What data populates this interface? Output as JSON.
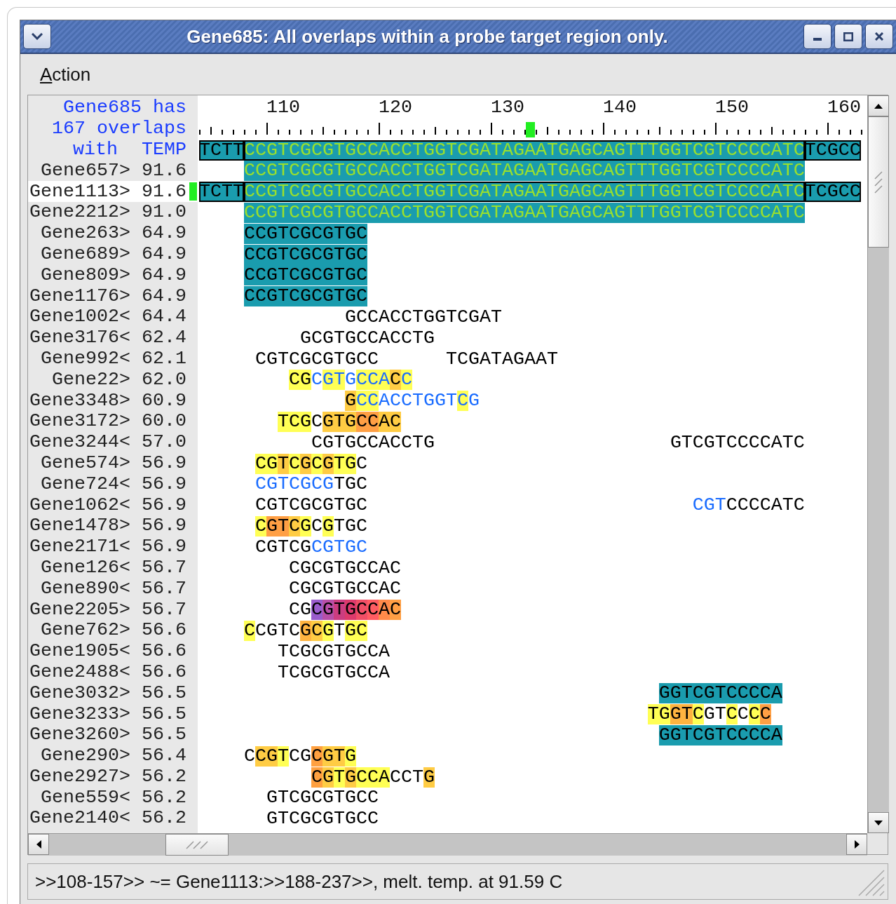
{
  "window": {
    "title": "Gene685: All overlaps within a probe target region only."
  },
  "menu": [
    "Action"
  ],
  "header": {
    "lines": [
      "Gene685 has",
      "167 overlaps"
    ],
    "label": "with",
    "temp": "TEMP"
  },
  "ruler": {
    "labels": [
      "110",
      "120",
      "130",
      "140",
      "150",
      "160"
    ]
  },
  "probe": {
    "outlined": true,
    "runs": [
      {
        "kind": "plain",
        "text": "TCTT",
        "color": "#1a9cae"
      },
      {
        "kind": "green",
        "text": "CCGTCGCGTGCCACCTGGTCGATAGAATGAGCAGTTTGGTCGTCCCCATC",
        "color": "#1a9cae"
      },
      {
        "kind": "plain",
        "text": "TCGCC",
        "color": "#1a9cae"
      }
    ]
  },
  "rows": [
    {
      "label": "Gene657>",
      "temp": "91.6",
      "selected": false,
      "outlined": false,
      "runs": [
        {
          "kind": "green",
          "text": "    CCGTCGCGTGCCACCTGGTCGATAGAATGAGCAGTTTGGTCGTCCCCATC",
          "color": "#1a9cae"
        }
      ]
    },
    {
      "label": "Gene1113>",
      "temp": "91.6",
      "selected": true,
      "outlined": true,
      "runs": [
        {
          "kind": "plain",
          "text": "TCTT",
          "color": "#1a9cae"
        },
        {
          "kind": "green",
          "text": "CCGTCGCGTGCCACCTGGTCGATAGAATGAGCAGTTTGGTCGTCCCCATC",
          "color": "#1a9cae"
        },
        {
          "kind": "plain",
          "text": "TCGCC",
          "color": "#1a9cae"
        }
      ]
    },
    {
      "label": "Gene2212>",
      "temp": "91.0",
      "selected": false,
      "outlined": false,
      "runs": [
        {
          "kind": "green",
          "text": "    CCGTCGCGTGCCACCTGGTCGATAGAATGAGCAGTTTGGTCGTCCCCATC",
          "color": "#1a9cae"
        }
      ]
    },
    {
      "label": "Gene263>",
      "temp": "64.9",
      "selected": false,
      "outlined": false,
      "runs": [
        {
          "kind": "plain",
          "text": "    CCGTCGCGTGC",
          "color": "#1a9cae"
        }
      ]
    },
    {
      "label": "Gene689>",
      "temp": "64.9",
      "selected": false,
      "outlined": false,
      "runs": [
        {
          "kind": "plain",
          "text": "    CCGTCGCGTGC",
          "color": "#1a9cae"
        }
      ]
    },
    {
      "label": "Gene809>",
      "temp": "64.9",
      "selected": false,
      "outlined": false,
      "runs": [
        {
          "kind": "plain",
          "text": "    CCGTCGCGTGC",
          "color": "#1a9cae"
        }
      ]
    },
    {
      "label": "Gene1176>",
      "temp": "64.9",
      "selected": false,
      "outlined": false,
      "runs": [
        {
          "kind": "plain",
          "text": "    CCGTCGCGTGC",
          "color": "#1a9cae"
        }
      ]
    },
    {
      "label": "Gene1002<",
      "temp": "64.4",
      "selected": false,
      "outlined": false,
      "runs": [
        {
          "kind": "plain",
          "text": "             GCCACCTGGTCGAT"
        }
      ]
    },
    {
      "label": "Gene3176<",
      "temp": "62.4",
      "selected": false,
      "outlined": false,
      "runs": [
        {
          "kind": "plain",
          "text": "         GCGTGCCACCTG"
        }
      ]
    },
    {
      "label": "Gene992<",
      "temp": "62.1",
      "selected": false,
      "outlined": false,
      "runs": [
        {
          "kind": "plain",
          "text": "     CGTCGCGTGCC"
        },
        {
          "kind": "plain",
          "text": "      TCGATAGAAT"
        }
      ]
    },
    {
      "label": "Gene22>",
      "temp": "62.0",
      "selected": false,
      "outlined": false,
      "runs": [
        {
          "kind": "plain",
          "text": "        CG",
          "color": "#ffff55"
        },
        {
          "kind": "blue",
          "text": "C"
        },
        {
          "kind": "blue",
          "text": "GT",
          "color": "#ffff55"
        },
        {
          "kind": "blue",
          "text": "G"
        },
        {
          "kind": "blue",
          "text": "CCA",
          "color": "#ffff55"
        },
        {
          "kind": "plain",
          "text": "C",
          "color": "#ffcc44"
        },
        {
          "kind": "blue",
          "text": "C",
          "color": "#ffff55"
        }
      ]
    },
    {
      "label": "Gene3348>",
      "temp": "60.9",
      "selected": false,
      "outlined": false,
      "runs": [
        {
          "kind": "plain",
          "text": "             G",
          "color": "#ffcc44"
        },
        {
          "kind": "blue",
          "text": "CC",
          "color": "#ffff55"
        },
        {
          "kind": "blue",
          "text": "ACCTGGT"
        },
        {
          "kind": "blue",
          "text": "C",
          "color": "#ffff55"
        },
        {
          "kind": "blue",
          "text": "G"
        }
      ]
    },
    {
      "label": "Gene3172>",
      "temp": "60.0",
      "selected": false,
      "outlined": false,
      "runs": [
        {
          "kind": "plain",
          "text": "       TCG",
          "color": "#ffff55"
        },
        {
          "kind": "plain",
          "text": "C"
        },
        {
          "kind": "plain",
          "text": "GTG",
          "color": "#ffcc44"
        },
        {
          "kind": "plain",
          "text": "CC",
          "color": "#ff9f44"
        },
        {
          "kind": "plain",
          "text": "AC",
          "color": "#ffcc44"
        }
      ]
    },
    {
      "label": "Gene3244<",
      "temp": "57.0",
      "selected": false,
      "outlined": false,
      "runs": [
        {
          "kind": "plain",
          "text": "          CGTGCCACCTG"
        },
        {
          "kind": "plain",
          "text": "                     GTCGTCCCCATC"
        }
      ]
    },
    {
      "label": "Gene574>",
      "temp": "56.9",
      "selected": false,
      "outlined": false,
      "runs": [
        {
          "kind": "plain",
          "text": "     CG",
          "color": "#ffff55"
        },
        {
          "kind": "plain",
          "text": "T",
          "color": "#ffcc44"
        },
        {
          "kind": "plain",
          "text": "C",
          "color": "#ffff55"
        },
        {
          "kind": "plain",
          "text": "G",
          "color": "#ffcc44"
        },
        {
          "kind": "plain",
          "text": "C",
          "color": "#ffff55"
        },
        {
          "kind": "plain",
          "text": "G",
          "color": "#ffcc44"
        },
        {
          "kind": "plain",
          "text": "TG",
          "color": "#ffff55"
        },
        {
          "kind": "plain",
          "text": "C"
        }
      ]
    },
    {
      "label": "Gene724<",
      "temp": "56.9",
      "selected": false,
      "outlined": false,
      "runs": [
        {
          "kind": "blue",
          "text": "     CGTCGCG"
        },
        {
          "kind": "plain",
          "text": "TGC"
        }
      ]
    },
    {
      "label": "Gene1062<",
      "temp": "56.9",
      "selected": false,
      "outlined": false,
      "runs": [
        {
          "kind": "plain",
          "text": "     CGTCGCGTGC"
        },
        {
          "kind": "blue",
          "text": "                             CGT"
        },
        {
          "kind": "plain",
          "text": "CCCCATC"
        }
      ]
    },
    {
      "label": "Gene1478>",
      "temp": "56.9",
      "selected": false,
      "outlined": false,
      "runs": [
        {
          "kind": "plain",
          "text": "     C",
          "color": "#ffff55"
        },
        {
          "kind": "plain",
          "text": "GT",
          "color": "#ff9f44"
        },
        {
          "kind": "plain",
          "text": "C",
          "color": "#ffcc44"
        },
        {
          "kind": "plain",
          "text": "G",
          "color": "#ffff55"
        },
        {
          "kind": "plain",
          "text": "C"
        },
        {
          "kind": "plain",
          "text": "G",
          "color": "#ffff55"
        },
        {
          "kind": "plain",
          "text": "TGC"
        }
      ]
    },
    {
      "label": "Gene2171<",
      "temp": "56.9",
      "selected": false,
      "outlined": false,
      "runs": [
        {
          "kind": "plain",
          "text": "     CGTCG"
        },
        {
          "kind": "blue",
          "text": "CGTGC"
        }
      ]
    },
    {
      "label": "Gene126<",
      "temp": "56.7",
      "selected": false,
      "outlined": false,
      "runs": [
        {
          "kind": "plain",
          "text": "        CGCGTGCCAC"
        }
      ]
    },
    {
      "label": "Gene890<",
      "temp": "56.7",
      "selected": false,
      "outlined": false,
      "runs": [
        {
          "kind": "plain",
          "text": "        CGCGTGCCAC"
        }
      ]
    },
    {
      "label": "Gene2205>",
      "temp": "56.7",
      "selected": false,
      "outlined": false,
      "runs": [
        {
          "kind": "plain",
          "text": "        CG"
        },
        {
          "kind": "plain",
          "text": "C",
          "color": "#9a5ccc"
        },
        {
          "kind": "plain",
          "text": "G",
          "color": "#b94fa8"
        },
        {
          "kind": "plain",
          "text": "T",
          "color": "#cc3d80"
        },
        {
          "kind": "plain",
          "text": "G",
          "color": "#dd3a6c"
        },
        {
          "kind": "plain",
          "text": "C",
          "color": "#f04e66"
        },
        {
          "kind": "plain",
          "text": "C",
          "color": "#ff5c62"
        },
        {
          "kind": "plain",
          "text": "A",
          "color": "#ff8a4a"
        },
        {
          "kind": "plain",
          "text": "C",
          "color": "#ff9f44"
        }
      ]
    },
    {
      "label": "Gene762>",
      "temp": "56.6",
      "selected": false,
      "outlined": false,
      "runs": [
        {
          "kind": "plain",
          "text": "    C",
          "color": "#ffff55"
        },
        {
          "kind": "plain",
          "text": "CGTC"
        },
        {
          "kind": "plain",
          "text": "G",
          "color": "#ffb340"
        },
        {
          "kind": "plain",
          "text": "C",
          "color": "#ffcc44"
        },
        {
          "kind": "plain",
          "text": "G",
          "color": "#ffff55"
        },
        {
          "kind": "plain",
          "text": "T"
        },
        {
          "kind": "plain",
          "text": "GC",
          "color": "#ffff55"
        }
      ]
    },
    {
      "label": "Gene1905<",
      "temp": "56.6",
      "selected": false,
      "outlined": false,
      "runs": [
        {
          "kind": "plain",
          "text": "       TCGCGTGCCA"
        }
      ]
    },
    {
      "label": "Gene2488<",
      "temp": "56.6",
      "selected": false,
      "outlined": false,
      "runs": [
        {
          "kind": "plain",
          "text": "       TCGCGTGCCA"
        }
      ]
    },
    {
      "label": "Gene3032>",
      "temp": "56.5",
      "selected": false,
      "outlined": false,
      "runs": [
        {
          "kind": "plain",
          "text": "                                         GGTCGTCCCCA",
          "color": "#1a9cae"
        }
      ]
    },
    {
      "label": "Gene3233>",
      "temp": "56.5",
      "selected": false,
      "outlined": false,
      "runs": [
        {
          "kind": "plain",
          "text": "                                        TG",
          "color": "#ffff55"
        },
        {
          "kind": "plain",
          "text": "GT",
          "color": "#ffb340"
        },
        {
          "kind": "plain",
          "text": "C",
          "color": "#ffff55"
        },
        {
          "kind": "plain",
          "text": "GT"
        },
        {
          "kind": "plain",
          "text": "C",
          "color": "#ffff55"
        },
        {
          "kind": "plain",
          "text": "C"
        },
        {
          "kind": "plain",
          "text": "C",
          "color": "#ffff55"
        },
        {
          "kind": "plain",
          "text": "C",
          "color": "#ff9f44"
        }
      ]
    },
    {
      "label": "Gene3260>",
      "temp": "56.5",
      "selected": false,
      "outlined": false,
      "runs": [
        {
          "kind": "plain",
          "text": "                                         GGTCGTCCCCA",
          "color": "#1a9cae"
        }
      ]
    },
    {
      "label": "Gene290>",
      "temp": "56.4",
      "selected": false,
      "outlined": false,
      "runs": [
        {
          "kind": "plain",
          "text": "    C"
        },
        {
          "kind": "plain",
          "text": "CG",
          "color": "#ffcc44"
        },
        {
          "kind": "plain",
          "text": "T",
          "color": "#ffff55"
        },
        {
          "kind": "plain",
          "text": "CG"
        },
        {
          "kind": "plain",
          "text": "C",
          "color": "#ffa040"
        },
        {
          "kind": "plain",
          "text": "GT",
          "color": "#ffcc44"
        },
        {
          "kind": "plain",
          "text": "G",
          "color": "#ffff55"
        }
      ]
    },
    {
      "label": "Gene2927>",
      "temp": "56.2",
      "selected": false,
      "outlined": false,
      "runs": [
        {
          "kind": "plain",
          "text": "          C",
          "color": "#ffa040"
        },
        {
          "kind": "plain",
          "text": "G",
          "color": "#ffcc44"
        },
        {
          "kind": "plain",
          "text": "T",
          "color": "#ffff55"
        },
        {
          "kind": "plain",
          "text": "G",
          "color": "#ffcc44"
        },
        {
          "kind": "plain",
          "text": "CCA",
          "color": "#ffff55"
        },
        {
          "kind": "plain",
          "text": "CCT"
        },
        {
          "kind": "plain",
          "text": "G",
          "color": "#ffcc44"
        }
      ]
    },
    {
      "label": "Gene559<",
      "temp": "56.2",
      "selected": false,
      "outlined": false,
      "runs": [
        {
          "kind": "plain",
          "text": "      GTCGCGTGCC"
        }
      ]
    },
    {
      "label": "Gene2140<",
      "temp": "56.2",
      "selected": false,
      "outlined": false,
      "runs": [
        {
          "kind": "plain",
          "text": "      GTCGCGTGCC"
        }
      ]
    }
  ],
  "status": ">>108-157>> ~= Gene1113:>>188-237>>, melt. temp. at 91.59 C"
}
